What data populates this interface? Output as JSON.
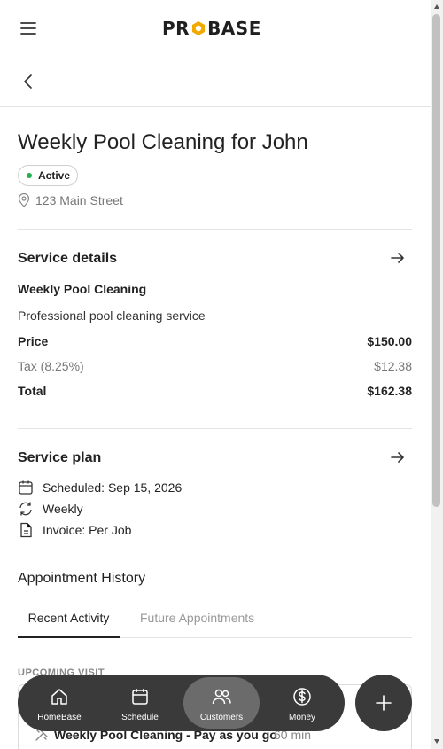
{
  "header": {
    "logo_left": "PR",
    "logo_right": "BASE",
    "menu_icon": "hamburger-icon",
    "back_icon": "chevron-left-icon"
  },
  "job": {
    "title": "Weekly Pool Cleaning for John",
    "status": "Active",
    "status_color": "#22b14c",
    "address": "123 Main Street"
  },
  "service_details": {
    "section_title": "Service details",
    "service_name": "Weekly Pool Cleaning",
    "description": "Professional pool cleaning service",
    "price_label": "Price",
    "price_value": "$150.00",
    "tax_label": "Tax (8.25%)",
    "tax_value": "$12.38",
    "total_label": "Total",
    "total_value": "$162.38"
  },
  "service_plan": {
    "section_title": "Service plan",
    "scheduled": "Scheduled: Sep 15, 2026",
    "frequency": "Weekly",
    "invoice": "Invoice: Per Job"
  },
  "history": {
    "title": "Appointment History",
    "tabs": [
      {
        "label": "Recent Activity",
        "active": true
      },
      {
        "label": "Future Appointments",
        "active": false
      }
    ],
    "upcoming_label": "UPCOMING VISIT",
    "visit_title": "Weekly Pool Cleaning - Pay as you go",
    "visit_duration": "60 min"
  },
  "bottom_nav": {
    "items": [
      {
        "label": "HomeBase",
        "icon": "home-icon",
        "active": false
      },
      {
        "label": "Schedule",
        "icon": "calendar-icon",
        "active": false
      },
      {
        "label": "Customers",
        "icon": "users-icon",
        "active": true
      },
      {
        "label": "Money",
        "icon": "dollar-icon",
        "active": false
      }
    ],
    "fab_icon": "plus-icon"
  },
  "colors": {
    "accent_orange": "#f2a900",
    "nav_background": "#3a3a3a",
    "nav_active": "#6b6b6b"
  }
}
